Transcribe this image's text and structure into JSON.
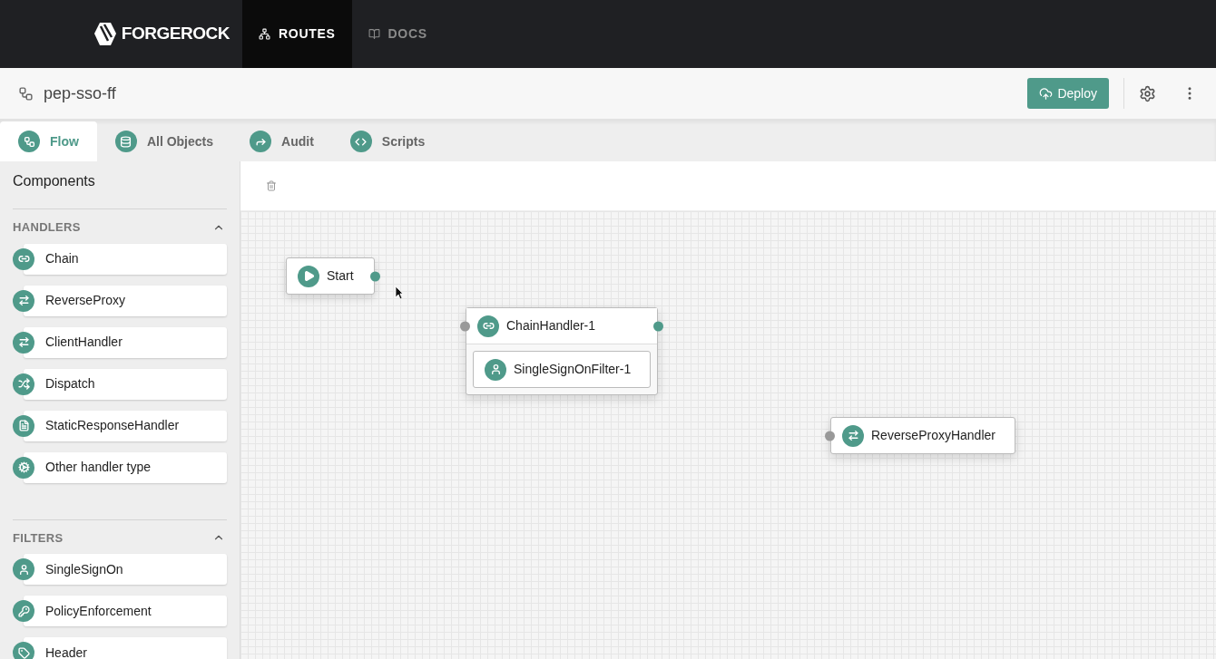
{
  "brand": {
    "name": "FORGEROCK"
  },
  "nav": [
    {
      "label": "ROUTES",
      "kind": "routes",
      "selected": true
    },
    {
      "label": "DOCS",
      "kind": "docs",
      "selected": false
    }
  ],
  "header": {
    "title": "pep-sso-ff",
    "deploy": "Deploy"
  },
  "tabs": [
    {
      "label": "Flow",
      "kind": "flow",
      "selected": true
    },
    {
      "label": "All Objects",
      "kind": "objects",
      "selected": false
    },
    {
      "label": "Audit",
      "kind": "audit",
      "selected": false
    },
    {
      "label": "Scripts",
      "kind": "scripts",
      "selected": false
    }
  ],
  "sidebar": {
    "title": "Components",
    "sections": [
      {
        "title": "HANDLERS",
        "expanded": true,
        "items": [
          {
            "label": "Chain",
            "kind": "chain"
          },
          {
            "label": "ReverseProxy",
            "kind": "proxy"
          },
          {
            "label": "ClientHandler",
            "kind": "proxy"
          },
          {
            "label": "Dispatch",
            "kind": "dispatch"
          },
          {
            "label": "StaticResponseHandler",
            "kind": "static"
          },
          {
            "label": "Other handler type",
            "kind": "other"
          }
        ]
      },
      {
        "title": "FILTERS",
        "expanded": true,
        "items": [
          {
            "label": "SingleSignOn",
            "kind": "sso"
          },
          {
            "label": "PolicyEnforcement",
            "kind": "policy"
          },
          {
            "label": "Header",
            "kind": "header"
          }
        ]
      }
    ]
  },
  "canvas": {
    "nodes": [
      {
        "label": "Start",
        "kind": "start"
      },
      {
        "label": "ChainHandler-1",
        "kind": "chain",
        "filters": [
          {
            "label": "SingleSignOnFilter-1",
            "kind": "sso"
          }
        ]
      },
      {
        "label": "ReverseProxyHandler",
        "kind": "proxy"
      }
    ]
  }
}
